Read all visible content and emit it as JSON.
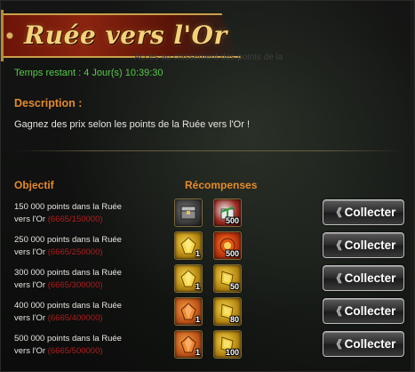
{
  "header": {
    "title": "Ruée vers l'Or",
    "subtitle_faint": "Accès au classement des points de la Ruée"
  },
  "time_remaining": "Temps restant : 4 Jour(s)  10:39:30",
  "description": {
    "title": "Description :",
    "text": "Gagnez des prix selon les points de la Ruée vers l'Or !"
  },
  "columns": {
    "objective": "Objectif",
    "rewards": "Récompenses"
  },
  "colors": {
    "accent_orange": "#e58a2a",
    "timer_green": "#58c84a",
    "progress_red": "#b01e1e",
    "title_gold": "#f3d27a"
  },
  "collect_label": "Collecter",
  "rows": [
    {
      "line1": "150 000 points dans la Ruée",
      "line2": "vers l'Or",
      "progress": "(6665/150000)",
      "reward1": {
        "icon": "treasure-chest-icon",
        "qty": ""
      },
      "reward2": {
        "icon": "gift-box-icon",
        "qty": "500"
      }
    },
    {
      "line1": "250 000 points dans la Ruée",
      "line2": "vers l'Or",
      "progress": "(6665/250000)",
      "reward1": {
        "icon": "gold-crystal-icon",
        "qty": "1"
      },
      "reward2": {
        "icon": "fire-orb-icon",
        "qty": "500"
      }
    },
    {
      "line1": "300 000 points dans la Ruée",
      "line2": "vers l'Or",
      "progress": "(6665/300000)",
      "reward1": {
        "icon": "gold-crystal-icon",
        "qty": "1"
      },
      "reward2": {
        "icon": "gold-gem-icon",
        "qty": "50"
      }
    },
    {
      "line1": "400 000 points dans la Ruée",
      "line2": "vers l'Or",
      "progress": "(6665/400000)",
      "reward1": {
        "icon": "orange-crystal-icon",
        "qty": "1"
      },
      "reward2": {
        "icon": "gold-gem-icon",
        "qty": "80"
      }
    },
    {
      "line1": "500 000 points dans la Ruée",
      "line2": "vers l'Or",
      "progress": "(6665/500000)",
      "reward1": {
        "icon": "orange-crystal-icon",
        "qty": "1"
      },
      "reward2": {
        "icon": "gold-gem-icon",
        "qty": "100"
      }
    }
  ]
}
